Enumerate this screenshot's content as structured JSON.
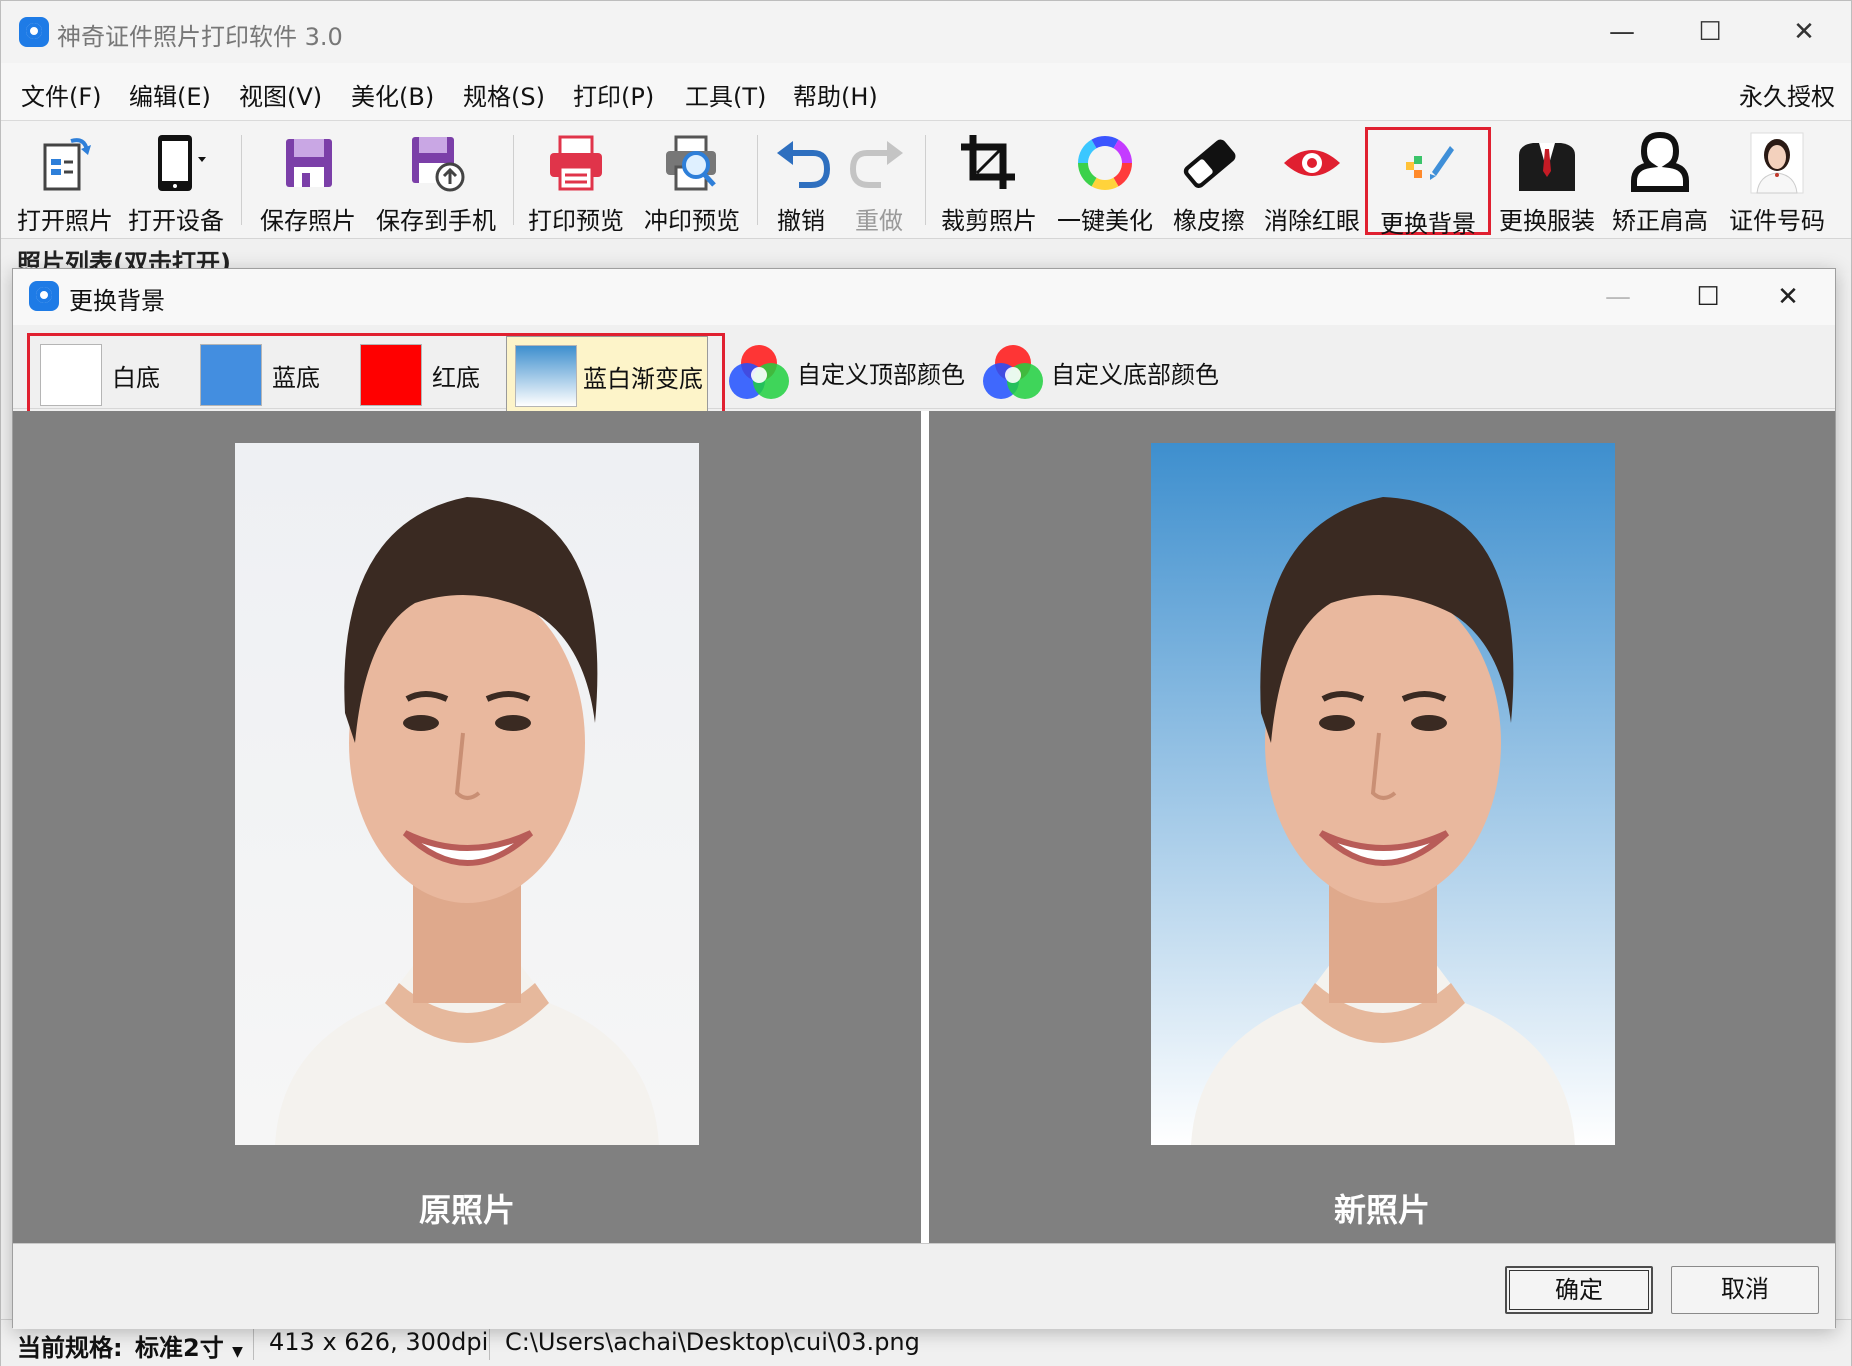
{
  "app": {
    "title": "神奇证件照片打印软件 3.0",
    "minimize": "—",
    "maximize": "☐",
    "close": "✕"
  },
  "menu": {
    "items": [
      "文件(F)",
      "编辑(E)",
      "视图(V)",
      "美化(B)",
      "规格(S)",
      "打印(P)",
      "工具(T)",
      "帮助(H)"
    ],
    "license": "永久授权"
  },
  "toolbar": {
    "items": [
      {
        "label": "打开照片",
        "icon": "open-photo-icon"
      },
      {
        "label": "打开设备",
        "icon": "phone-device-icon"
      },
      {
        "label": "保存照片",
        "icon": "save-icon"
      },
      {
        "label": "保存到手机",
        "icon": "save-to-phone-icon"
      },
      {
        "label": "打印预览",
        "icon": "printer-icon"
      },
      {
        "label": "冲印预览",
        "icon": "print-preview-search-icon"
      },
      {
        "label": "撤销",
        "icon": "undo-icon"
      },
      {
        "label": "重做",
        "icon": "redo-icon",
        "disabled": true
      },
      {
        "label": "裁剪照片",
        "icon": "crop-icon"
      },
      {
        "label": "一键美化",
        "icon": "color-wheel-icon"
      },
      {
        "label": "橡皮擦",
        "icon": "eraser-icon"
      },
      {
        "label": "消除红眼",
        "icon": "red-eye-icon"
      },
      {
        "label": "更换背景",
        "icon": "change-background-icon",
        "highlighted": true
      },
      {
        "label": "更换服装",
        "icon": "suit-icon"
      },
      {
        "label": "矫正肩高",
        "icon": "shoulder-icon"
      },
      {
        "label": "证件号码",
        "icon": "id-photo-icon"
      }
    ]
  },
  "behind": {
    "photo_list_label": "照片列表(双击打开)"
  },
  "dialog": {
    "title": "更换背景",
    "backgrounds": [
      {
        "label": "白底",
        "color": "#ffffff"
      },
      {
        "label": "蓝底",
        "color": "#438ee0"
      },
      {
        "label": "红底",
        "color": "#ff0000"
      },
      {
        "label": "蓝白渐变底",
        "color": "#3e8fce",
        "selected": true
      }
    ],
    "custom_top": "自定义顶部颜色",
    "custom_bottom": "自定义底部颜色",
    "original_caption": "原照片",
    "new_caption": "新照片",
    "ok": "确定",
    "cancel": "取消"
  },
  "status": {
    "spec_label": "当前规格:",
    "spec_value": "标准2寸",
    "size": "413 x 626, 300dpi",
    "path": "C:\\Users\\achai\\Desktop\\cui\\03.png"
  },
  "colors": {
    "highlight_border": "#e02030",
    "preview_bg": "#808080",
    "selected_bg": "#fdf4c9"
  }
}
